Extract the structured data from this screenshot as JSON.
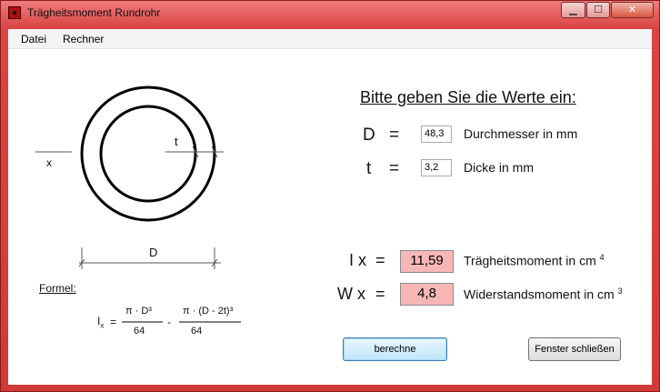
{
  "window": {
    "title": "Trägheitsmoment Rundrohr",
    "min_symbol": "▁",
    "max_symbol": "☐",
    "close_symbol": "✕"
  },
  "menu": [
    "Datei",
    "Rechner"
  ],
  "diagram": {
    "t_label": "t",
    "x_label": "x",
    "d_label": "D"
  },
  "formula": {
    "heading": "Formel:",
    "ix": "I",
    "ix_sub": "x",
    "equals": "=",
    "num1": "π ·  D³",
    "den1": "64",
    "minus": "-",
    "num2": "π ·  (D - 2t)³",
    "den2": "64"
  },
  "input_section": {
    "heading": "Bitte geben Sie die Werte ein:",
    "D": {
      "symbol": "D",
      "equals": "=",
      "value": "48,3",
      "description": "Durchmesser in mm"
    },
    "t": {
      "symbol": "t",
      "equals": "=",
      "value": "3,2",
      "description": "Dicke in mm"
    }
  },
  "results": {
    "Ix": {
      "symbol": "I x",
      "equals": "=",
      "value": "11,59",
      "description": "Trägheitsmoment in cm",
      "exp": "4"
    },
    "Wx": {
      "symbol": "W x",
      "equals": "=",
      "value": "4,8",
      "description": "Widerstandsmoment in cm",
      "exp": "3"
    }
  },
  "buttons": {
    "calculate": "berechne",
    "close": "Fenster schließen"
  }
}
